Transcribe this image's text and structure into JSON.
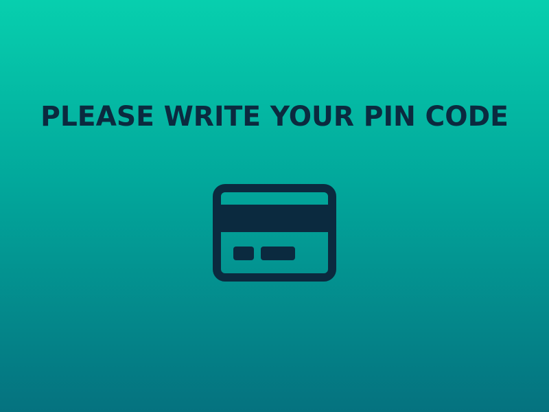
{
  "screen": {
    "prompt": "PLEASE WRITE YOUR PIN CODE",
    "icon": "credit-card-icon",
    "colors": {
      "background_top": "#07cfae",
      "background_bottom": "#05727f",
      "foreground": "#0b2a3f"
    }
  }
}
